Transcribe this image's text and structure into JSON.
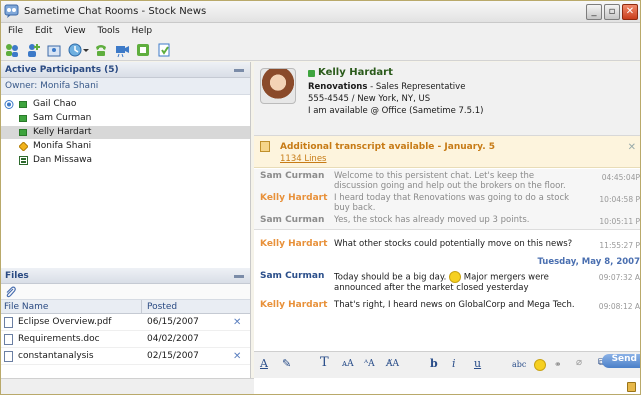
{
  "window": {
    "title": "Sametime Chat Rooms - Stock News"
  },
  "menu": [
    "File",
    "Edit",
    "View",
    "Tools",
    "Help"
  ],
  "toolbar": {
    "icons": [
      "people-icon",
      "add-user-icon",
      "room-icon",
      "status-icon",
      "call-icon",
      "video-icon",
      "record-icon",
      "export-icon"
    ]
  },
  "participants": {
    "header": "Active Participants (5)",
    "owner": "Owner: Monifa Shani",
    "list": [
      {
        "name": "Gail Chao",
        "status": "available",
        "extra": "speaking-icon"
      },
      {
        "name": "Sam Curman",
        "status": "available"
      },
      {
        "name": "Kelly Hardart",
        "status": "available",
        "selected": true
      },
      {
        "name": "Monifa Shani",
        "status": "away"
      },
      {
        "name": "Dan Missawa",
        "status": "meeting"
      }
    ]
  },
  "files": {
    "header": "Files",
    "columns": [
      "File Name",
      "Posted"
    ],
    "rows": [
      {
        "name": "Eclipse Overview.pdf",
        "date": "06/15/2007"
      },
      {
        "name": "Requirements.doc",
        "date": "04/02/2007"
      },
      {
        "name": "constantanalysis",
        "date": "02/15/2007"
      }
    ]
  },
  "profile": {
    "name": "Kelly Hardart",
    "company": "Renovations",
    "role": " - Sales Representative",
    "contact": "555-4545 / New York, NY, US",
    "status": "I am available @ Office (Sametime 7.5.1)"
  },
  "transcript": {
    "title": "Additional transcript available - January. 5",
    "link": "1134 Lines"
  },
  "messages": [
    {
      "who": "Sam Curman",
      "text": "Welcome to this persistent chat. Let's keep the discussion going and help out the brokers on the floor.",
      "time": "04:45:04P",
      "old": true
    },
    {
      "who": "Kelly Hardart",
      "text": "I heard today that Renovations was going to do a stock buy back.",
      "time": "10:04:58 P",
      "old": true
    },
    {
      "who": "Sam Curman",
      "text": "Yes, the stock has already moved up 3 points.",
      "time": "10:05:11 P",
      "old": true
    },
    {
      "who": "Kelly Hardart",
      "text": "What other stocks could potentially move on this news?",
      "time": "11:55:27 P",
      "old": false
    },
    {
      "who": "Sam Curman",
      "text": "Today should be a big day.",
      "text2": " Major mergers were announced after the market closed yesterday",
      "time": "09:07:32 A",
      "old": false
    },
    {
      "who": "Kelly Hardart",
      "text": "That's right, I heard news on GlobalCorp and Mega Tech.",
      "time": "09:08:12 A",
      "old": false
    }
  ],
  "date_separator": "Tuesday, May 8, 2007",
  "format_bar": {
    "send_label": "Send"
  }
}
